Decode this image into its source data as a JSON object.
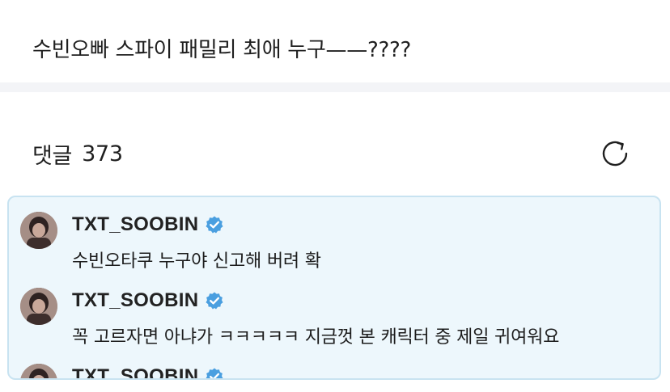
{
  "post": {
    "question": "수빈오빠 스파이 패밀리 최애 누구——????"
  },
  "comments_section": {
    "label": "댓글",
    "count": "373",
    "refresh_icon": "refresh-icon"
  },
  "colors": {
    "card_background": "#edf7fc",
    "card_border": "#c8e3f1",
    "verified_badge": "#4a9fe0",
    "divider": "#f3f4f7"
  },
  "comments": [
    {
      "author": "TXT_SOOBIN",
      "verified": true,
      "text": "수빈오타쿠 누구야 신고해 버려 확"
    },
    {
      "author": "TXT_SOOBIN",
      "verified": true,
      "text": "꼭 고르자면 아냐가 ㅋㅋㅋㅋㅋ 지금껏 본 캐릭터 중 제일 귀여워요"
    },
    {
      "author": "TXT_SOOBIN",
      "verified": true,
      "text": ""
    }
  ]
}
